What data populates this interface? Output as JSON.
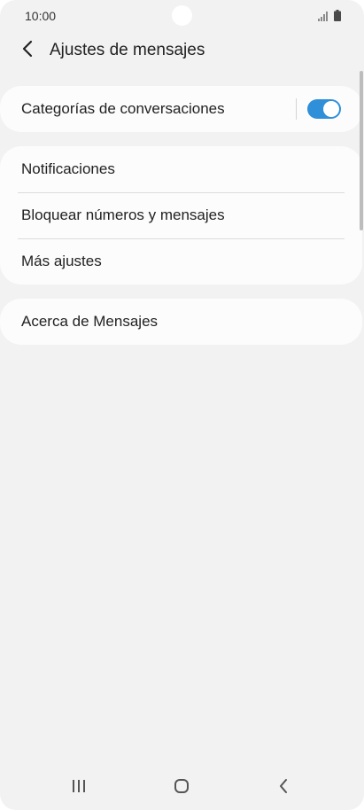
{
  "status_bar": {
    "time": "10:00",
    "icons": [
      "signal-icon",
      "battery-icon"
    ]
  },
  "header": {
    "title": "Ajustes de mensajes",
    "back_icon": "back-arrow-icon"
  },
  "sections": {
    "conversation_categories": {
      "label": "Categorías de conversaciones",
      "toggle_on": true
    },
    "settings_list": [
      {
        "label": "Notificaciones"
      },
      {
        "label": "Bloquear números y mensajes"
      },
      {
        "label": "Más ajustes"
      }
    ],
    "about": {
      "label": "Acerca de Mensajes"
    }
  },
  "nav_bar": {
    "icons": [
      "recents-icon",
      "home-icon",
      "back-icon"
    ]
  },
  "colors": {
    "background": "#f2f2f2",
    "card": "#fcfcfc",
    "accent": "#2f8fd8",
    "text": "#222222"
  }
}
